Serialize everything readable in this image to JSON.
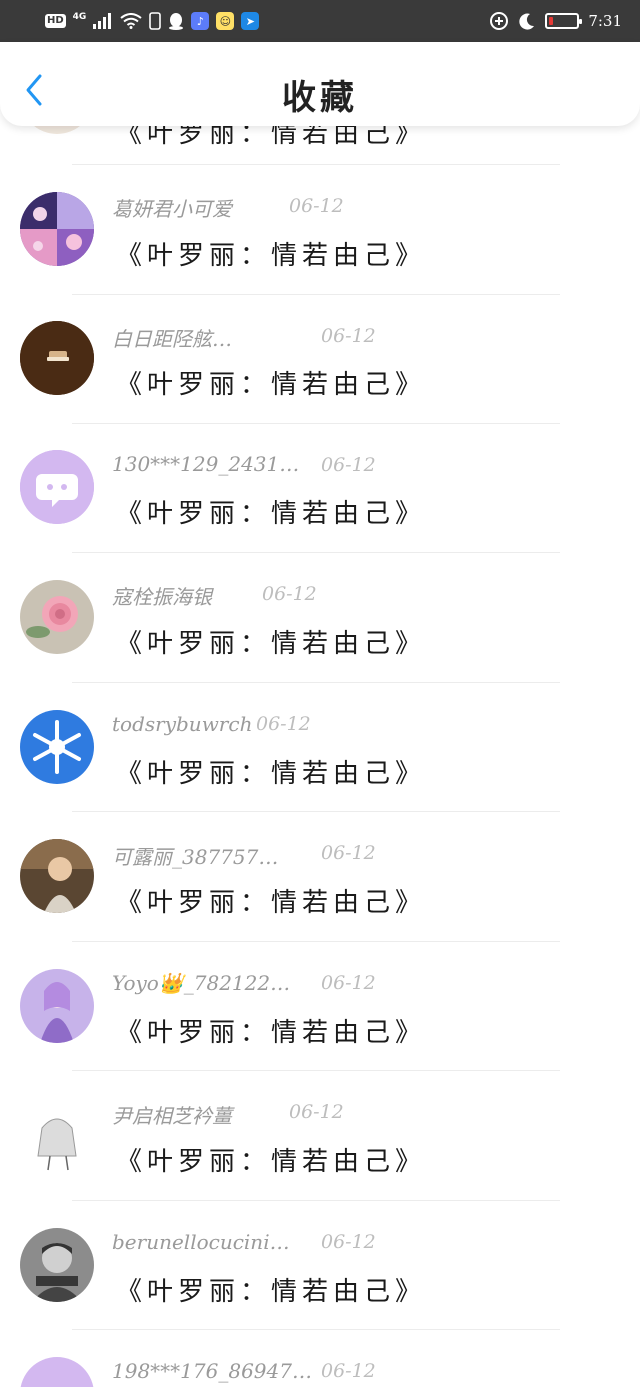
{
  "status_bar": {
    "hd": "HD",
    "network": "4G",
    "time": "7:31"
  },
  "header": {
    "title": "收藏",
    "back_icon": "chevron-left-icon"
  },
  "items": [
    {
      "user": "",
      "date": "",
      "book": "《叶罗丽：情若由己》"
    },
    {
      "user": "葛妍君小可爱",
      "date": "06-12",
      "book": "《叶罗丽：情若由己》"
    },
    {
      "user": "白日距陉舷…",
      "date": "06-12",
      "book": "《叶罗丽：情若由己》"
    },
    {
      "user": "130***129_2431…",
      "date": "06-12",
      "book": "《叶罗丽：情若由己》"
    },
    {
      "user": "寇栓振海银",
      "date": "06-12",
      "book": "《叶罗丽：情若由己》"
    },
    {
      "user": "todsrybuwrch",
      "date": "06-12",
      "book": "《叶罗丽：情若由己》"
    },
    {
      "user": "可露丽_387757…",
      "date": "06-12",
      "book": "《叶罗丽：情若由己》"
    },
    {
      "user": "Yoyo👑_782122…",
      "date": "06-12",
      "book": "《叶罗丽：情若由己》"
    },
    {
      "user": "尹启相芝衿薑",
      "date": "06-12",
      "book": "《叶罗丽：情若由己》"
    },
    {
      "user": "berunellocucini…",
      "date": "06-12",
      "book": "《叶罗丽：情若由己》"
    },
    {
      "user": "198***176_86947…",
      "date": "06-12",
      "book": ""
    }
  ],
  "colors": {
    "status_bg": "#3a3a3a",
    "accent_blue": "#2196f3",
    "username": "#9a9a9a",
    "date": "#bdbdbd",
    "book": "#1a1a1a",
    "default_avatar": "#d3b8f0"
  }
}
